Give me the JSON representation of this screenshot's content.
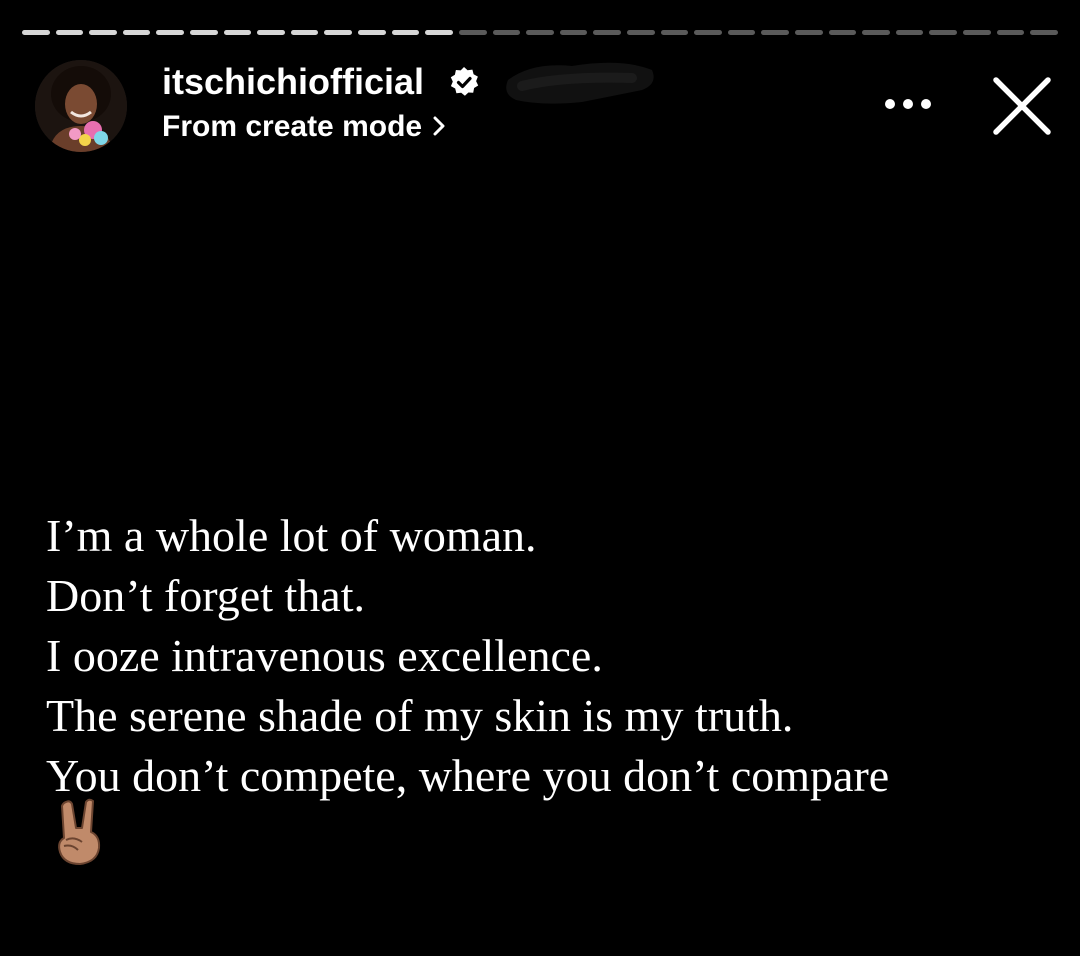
{
  "story": {
    "progress": {
      "segments": 31,
      "viewed": 13
    },
    "header": {
      "username": "itschichiofficial",
      "verified": true,
      "subtitle": "From create mode",
      "avatar_icon": "profile-photo-icon"
    },
    "controls": {
      "more_icon": "more-horizontal-icon",
      "close_icon": "close-icon"
    },
    "text_lines": [
      "I’m a whole lot of woman.",
      "Don’t forget that.",
      "I ooze intravenous excellence.",
      "The serene shade of my skin is my truth.",
      "You don’t compete, where you don’t compare"
    ],
    "emoji": "✌🏽"
  },
  "colors": {
    "background": "#000000",
    "text": "#ffffff",
    "progress_viewed": "#d6d6d6",
    "progress_pending": "#5a5a5a"
  }
}
